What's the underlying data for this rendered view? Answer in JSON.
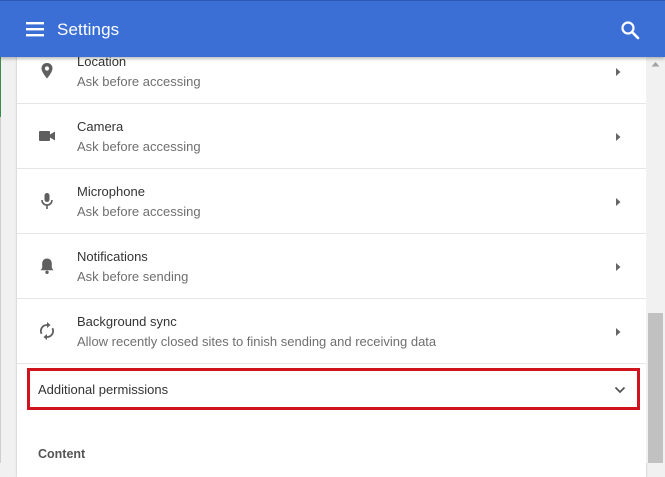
{
  "header": {
    "title": "Settings",
    "menu_icon": "hamburger-menu-icon",
    "search_icon": "search-icon",
    "background": "#3b6fd6"
  },
  "permissions": [
    {
      "icon": "location-pin-icon",
      "label": "Location",
      "description": "Ask before accessing"
    },
    {
      "icon": "camera-icon",
      "label": "Camera",
      "description": "Ask before accessing"
    },
    {
      "icon": "microphone-icon",
      "label": "Microphone",
      "description": "Ask before accessing"
    },
    {
      "icon": "bell-icon",
      "label": "Notifications",
      "description": "Ask before sending"
    },
    {
      "icon": "sync-icon",
      "label": "Background sync",
      "description": "Allow recently closed sites to finish sending and receiving data"
    }
  ],
  "additional_permissions": {
    "label": "Additional permissions",
    "icon": "chevron-down-icon",
    "highlight_color": "#d0141e"
  },
  "content_section": {
    "title": "Content"
  }
}
